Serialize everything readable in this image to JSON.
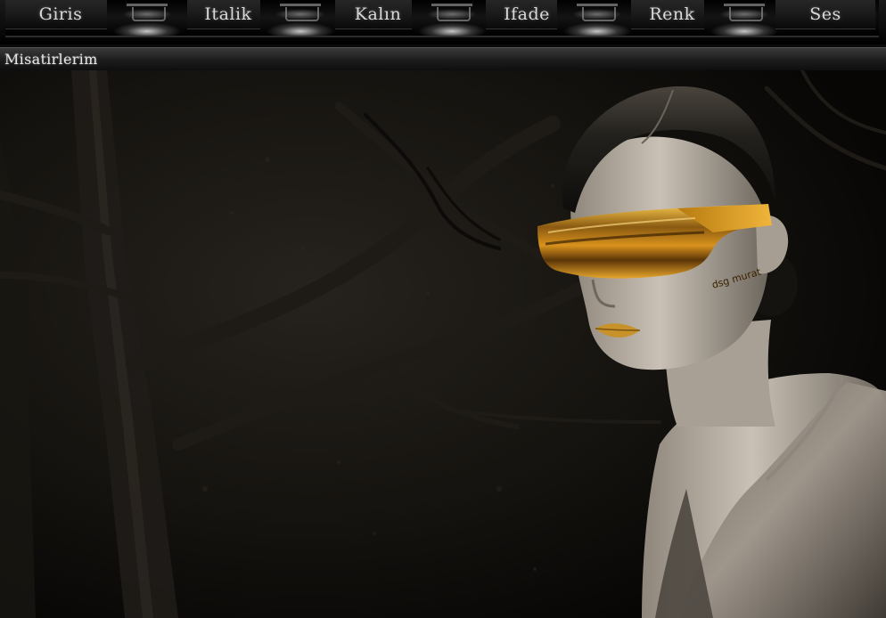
{
  "menu": {
    "items": [
      {
        "id": "giris",
        "label": "Giris"
      },
      {
        "id": "italik",
        "label": "Italik"
      },
      {
        "id": "kalin",
        "label": "Kalın"
      },
      {
        "id": "ifade",
        "label": "Ifade"
      },
      {
        "id": "renk",
        "label": "Renk"
      },
      {
        "id": "ses",
        "label": "Ses"
      }
    ]
  },
  "page": {
    "title": "Misatirlerim"
  },
  "artwork": {
    "watermark": "dsg murat",
    "colors": {
      "background": "#0b0a09",
      "glasses_gold": "#d89a1a",
      "lips_gold": "#c8922a",
      "skin": "#bfb7ac"
    }
  }
}
